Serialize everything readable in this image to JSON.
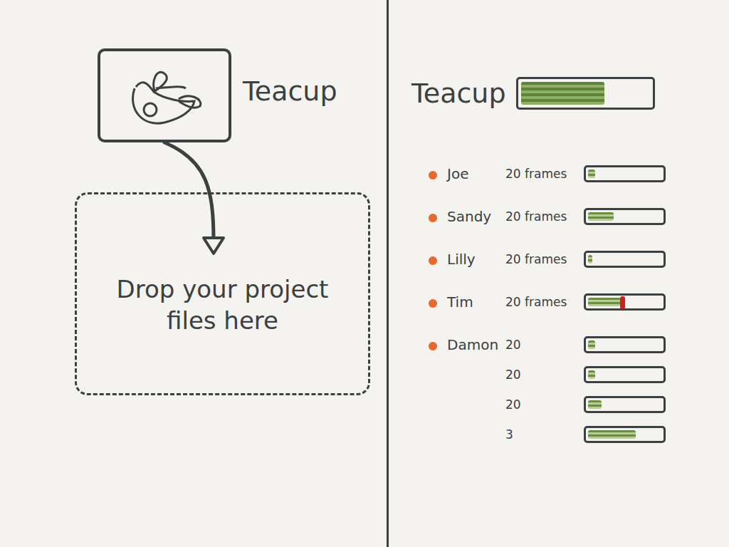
{
  "app": {
    "title": "Teacup"
  },
  "dropzone": {
    "label": "Drop your project files here"
  },
  "queue": {
    "title": "Teacup",
    "level": 0.65
  },
  "users": [
    {
      "name": "Joe",
      "jobs": [
        {
          "frames": "20 frames",
          "level": 0.1,
          "error": false
        }
      ]
    },
    {
      "name": "Sandy",
      "jobs": [
        {
          "frames": "20 frames",
          "level": 0.35,
          "error": false
        }
      ]
    },
    {
      "name": "Lilly",
      "jobs": [
        {
          "frames": "20 frames",
          "level": 0.06,
          "error": false
        }
      ]
    },
    {
      "name": "Tim",
      "jobs": [
        {
          "frames": "20 frames",
          "level": 0.45,
          "error": true
        }
      ]
    },
    {
      "name": "Damon",
      "jobs": [
        {
          "frames": "20",
          "level": 0.1,
          "error": false
        },
        {
          "frames": "20",
          "level": 0.1,
          "error": false
        },
        {
          "frames": "20",
          "level": 0.18,
          "error": false
        },
        {
          "frames": "3",
          "level": 0.65,
          "error": false
        }
      ]
    }
  ]
}
